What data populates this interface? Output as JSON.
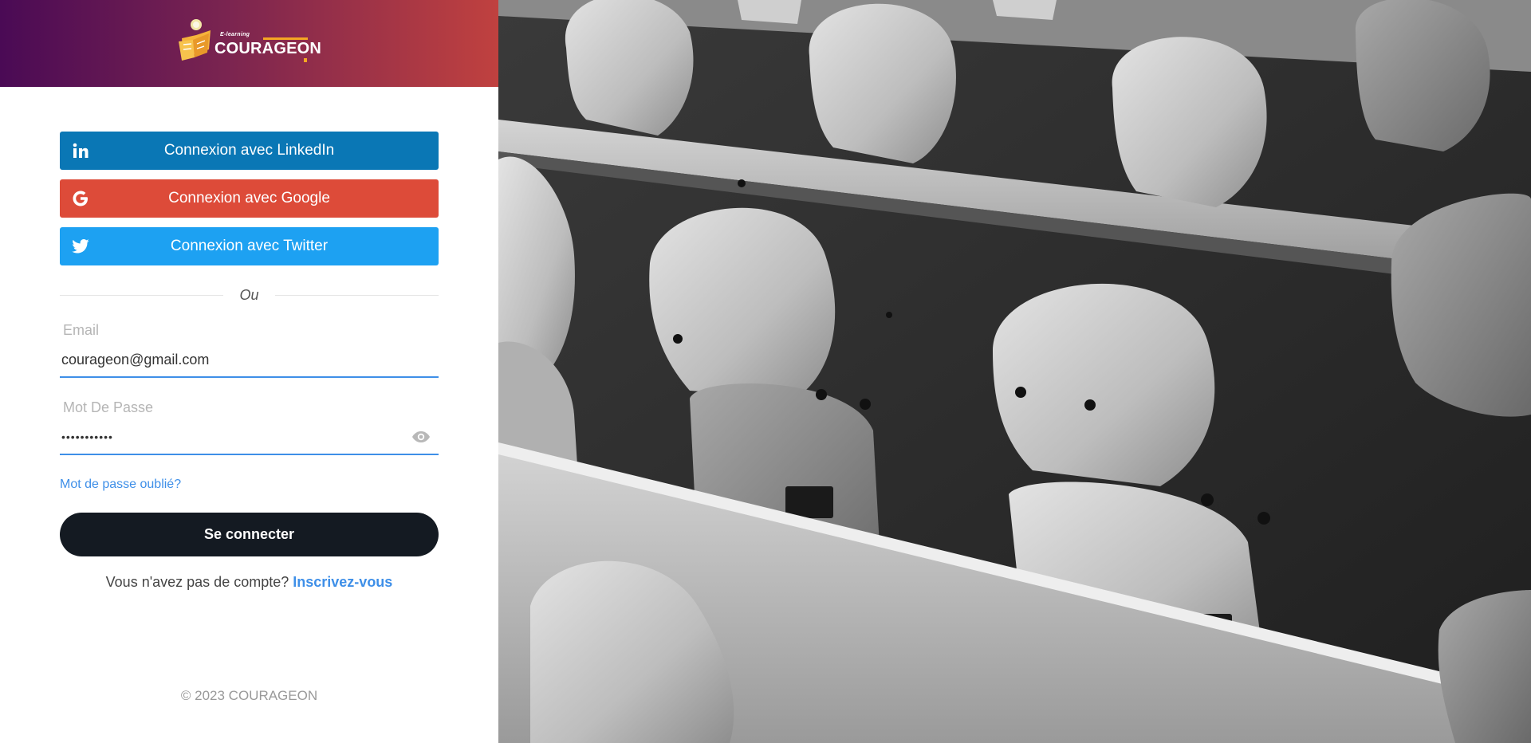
{
  "brand": {
    "tagline": "E-learning",
    "name": "COURAGEON"
  },
  "social_login": [
    {
      "label": "Connexion avec LinkedIn",
      "icon": "linkedin-icon",
      "color": "#0a77b5"
    },
    {
      "label": "Connexion avec Google",
      "icon": "google-icon",
      "color": "#dd4b39"
    },
    {
      "label": "Connexion avec Twitter",
      "icon": "twitter-icon",
      "color": "#1da1f2"
    }
  ],
  "divider_text": "Ou",
  "form": {
    "email": {
      "label": "Email",
      "value": "courageon@gmail.com"
    },
    "password": {
      "label": "Mot De Passe",
      "value": "•••••••••••"
    },
    "forgot_link": "Mot de passe oublié?",
    "submit_label": "Se connecter",
    "signup_prompt": "Vous n'avez pas de compte?",
    "signup_link": "Inscrivez-vous"
  },
  "footer": "© 2023 COURAGEON",
  "colors": {
    "accent": "#3e8fe8",
    "primary_button": "#141a22",
    "brand_gradient_start": "#4a0a55",
    "brand_gradient_end": "#c0413f"
  },
  "background_image": "black-and-white lecture hall with rows of wooden chairs"
}
